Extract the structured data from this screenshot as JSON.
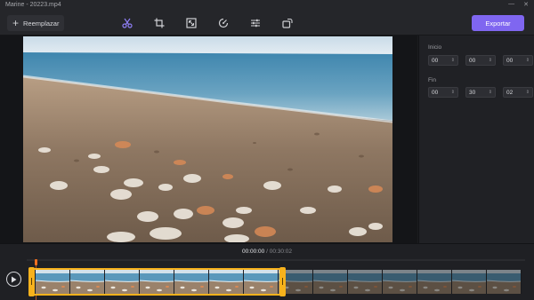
{
  "window": {
    "title": "Marine - 20223.mp4",
    "min_glyph": "—",
    "close_glyph": "✕"
  },
  "toolbar": {
    "replace_label": "Reemplazar",
    "export_label": "Exportar",
    "tools": [
      "scissors-icon",
      "crop-icon",
      "resize-icon",
      "speed-icon",
      "adjust-icon",
      "rotate-icon"
    ],
    "accent_color": "#7f66f0"
  },
  "trim": {
    "start_label": "Inicio",
    "start": [
      "00",
      "00",
      "00"
    ],
    "end_label": "Fin",
    "end": [
      "00",
      "30",
      "02"
    ]
  },
  "timeline": {
    "current_time": "00:00:00",
    "separator": " / ",
    "total_time": "00:30:02",
    "selection_color": "#f7b21c",
    "playhead_color": "#f2701f"
  }
}
